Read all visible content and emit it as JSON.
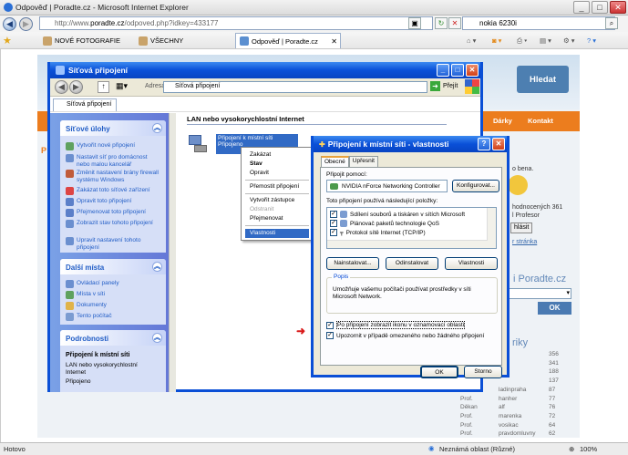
{
  "browser": {
    "title": "Odpověď | Poradte.cz - Microsoft Internet Explorer",
    "url_prefix": "http://www.",
    "url_domain": "poradte.cz",
    "url_path": "/odpoved.php?idkey=433177",
    "search_value": "nokia 6230i",
    "tab_label": "Odpověď | Poradte.cz",
    "favorites": [
      "NOVÉ FOTOGRAFIE",
      "VŠECHNY"
    ]
  },
  "site": {
    "search_button": "Hledat",
    "nav_items": [
      "Dárky",
      "Kontakt"
    ],
    "right_texts": [
      "o bena.",
      "hodnocených 361",
      "l Profesor",
      "hlásit",
      "r stránka"
    ],
    "poradte_heading": "i Poradte.cz",
    "ok_button": "OK",
    "rank_heading": "riky",
    "ranks": [
      {
        "rank": "",
        "name": "",
        "value": "356"
      },
      {
        "rank": "",
        "name": "",
        "value": "341"
      },
      {
        "rank": "",
        "name": "",
        "value": "188"
      },
      {
        "rank": "",
        "name": "",
        "value": "137"
      },
      {
        "rank": "Děkan",
        "name": "ladinpraha",
        "value": "87"
      },
      {
        "rank": "Prof.",
        "name": "hanher",
        "value": "77"
      },
      {
        "rank": "Děkan",
        "name": "alf",
        "value": "76"
      },
      {
        "rank": "Prof.",
        "name": "marenka",
        "value": "72"
      },
      {
        "rank": "Prof.",
        "name": "vosikac",
        "value": "64"
      },
      {
        "rank": "Prof.",
        "name": "pravdomluvny",
        "value": "62"
      }
    ]
  },
  "status": {
    "left": "Hotovo",
    "zone": "Neznámá oblast (Různé)",
    "zoom": "100%"
  },
  "net_window": {
    "title": "Síťová připojení",
    "address_label": "Adresa",
    "address_value": "Síťová připojení",
    "go_label": "Přejít",
    "tab_label": "Síťová připojení",
    "tasks_title": "Síťové úlohy",
    "tasks": [
      "Vytvořit nové připojení",
      "Nastavit síť pro domácnost nebo malou kancelář",
      "Změnit nastavení brány firewall systému Windows",
      "Zakázat toto síťové zařízení",
      "Opravit toto připojení",
      "Přejmenovat toto připojení",
      "Zobrazit stav tohoto připojení",
      "Upravit nastavení tohoto připojení"
    ],
    "other_title": "Další místa",
    "other": [
      "Ovládací panely",
      "Místa v síti",
      "Dokumenty",
      "Tento počítač"
    ],
    "details_title": "Podrobnosti",
    "details_name": "Připojení k místní síti",
    "details_desc": "LAN nebo vysokorychlostní Internet",
    "details_status": "Připojeno",
    "section_title": "LAN nebo vysokorychlostní Internet",
    "conn_name": "Připojení k místní síti",
    "conn_status": "Připojeno",
    "context_menu": [
      "Zakázat",
      "Stav",
      "Opravit",
      "Přemostit připojení",
      "Vytvořit zástupce",
      "Odstranit",
      "Přejmenovat",
      "Vlastnosti"
    ]
  },
  "props": {
    "title": "Připojení k místní síti - vlastnosti",
    "tabs": [
      "Obecné",
      "Upřesnit"
    ],
    "connect_using": "Připojit pomocí:",
    "adapter": "NVIDIA nForce Networking Controller",
    "configure": "Konfigurovat...",
    "uses_label": "Toto připojení používá následující položky:",
    "components": [
      "Sdílení souborů a tiskáren v sítích Microsoft",
      "Plánovač paketů technologie QoS",
      "Protokol sítě Internet (TCP/IP)"
    ],
    "install": "Nainstalovat...",
    "uninstall": "Odinstalovat",
    "properties": "Vlastnosti",
    "desc_label": "Popis",
    "desc_text": "Umožňuje vašemu počítači používat prostředky v síti Microsoft Network.",
    "check_show_icon": "Po připojení zobrazit ikonu v oznamovací oblasti",
    "check_notify": "Upozornit v případě omezeného nebo žádného připojení",
    "ok": "OK",
    "cancel": "Storno"
  }
}
